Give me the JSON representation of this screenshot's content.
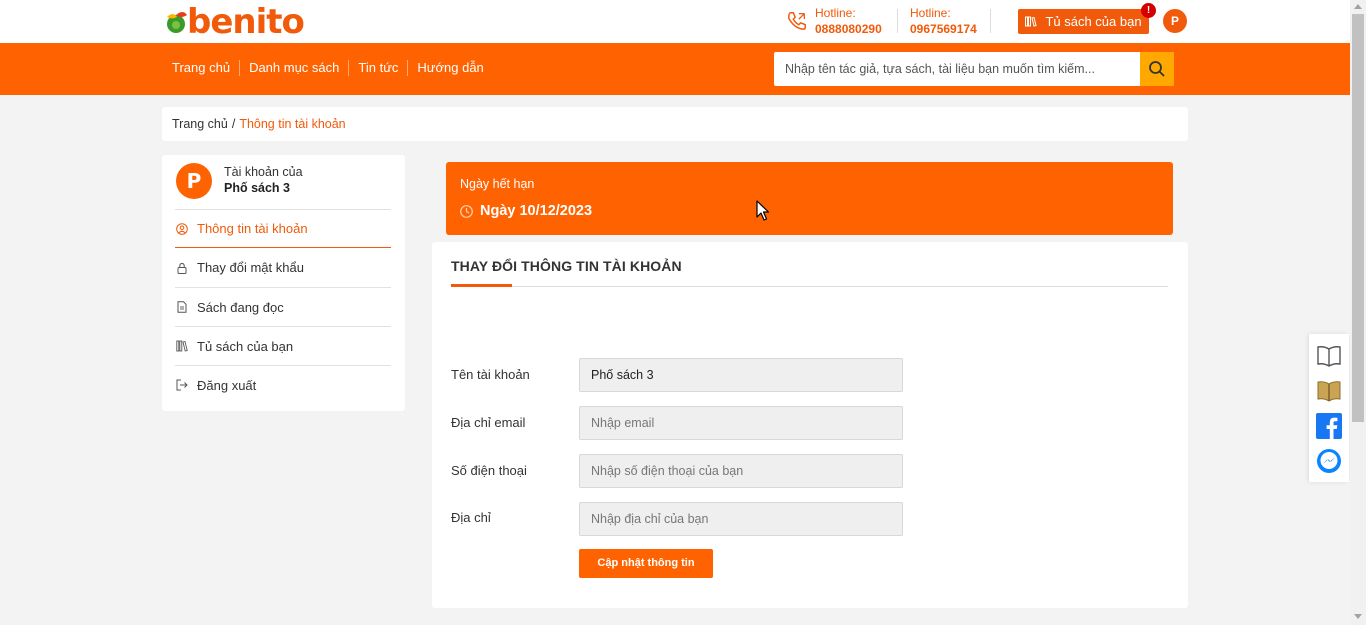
{
  "header": {
    "logo_text": "benito",
    "hotlines": [
      {
        "label": "Hotline:",
        "number": "0888080290"
      },
      {
        "label": "Hotline:",
        "number": "0967569174"
      }
    ],
    "bookshelf_button": "Tủ sách của bạn",
    "notification_badge": "!",
    "user_initial": "P"
  },
  "nav": {
    "items": [
      "Trang chủ",
      "Danh mục sách",
      "Tin tức",
      "Hướng dẫn"
    ],
    "search_placeholder": "Nhập tên tác giả, tựa sách, tài liệu bạn muốn tìm kiếm..."
  },
  "breadcrumb": {
    "home": "Trang chủ",
    "separator": "/",
    "current": "Thông tin tài khoản"
  },
  "sidebar": {
    "avatar_initial": "P",
    "owner_label": "Tài khoản của",
    "owner_name": "Phố sách 3",
    "items": [
      {
        "label": "Thông tin tài khoản",
        "icon": "user-circle-icon",
        "active": true
      },
      {
        "label": "Thay đổi mật khẩu",
        "icon": "lock-icon",
        "active": false
      },
      {
        "label": "Sách đang đọc",
        "icon": "document-icon",
        "active": false
      },
      {
        "label": "Tủ sách của bạn",
        "icon": "bookshelf-icon",
        "active": false
      },
      {
        "label": "Đăng xuất",
        "icon": "logout-icon",
        "active": false
      }
    ]
  },
  "expiry": {
    "label": "Ngày hết hạn",
    "date": "Ngày 10/12/2023"
  },
  "form": {
    "title": "THAY ĐỔI THÔNG TIN TÀI KHOẢN",
    "fields": [
      {
        "label": "Tên tài khoản",
        "value": "Phố sách 3",
        "placeholder": ""
      },
      {
        "label": "Địa chỉ email",
        "value": "",
        "placeholder": "Nhập email"
      },
      {
        "label": "Số điện thoại",
        "value": "",
        "placeholder": "Nhập số điện thoại của bạn"
      },
      {
        "label": "Địa chỉ",
        "value": "",
        "placeholder": "Nhập địa chỉ của bạn"
      }
    ],
    "submit_label": "Cập nhật thông tin"
  },
  "colors": {
    "accent": "#ff6200",
    "search_button": "#ffa800"
  },
  "floating_widgets": [
    "open-book-icon",
    "closed-book-icon",
    "facebook-icon",
    "messenger-icon"
  ]
}
